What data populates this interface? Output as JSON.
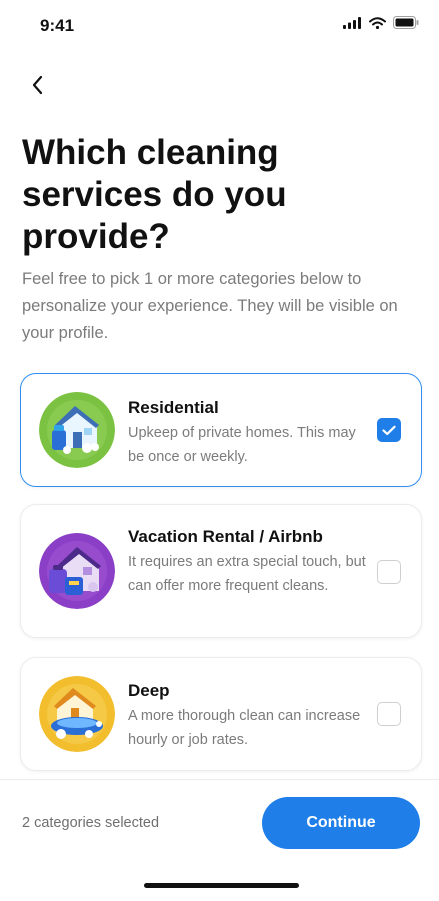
{
  "status_bar": {
    "time": "9:41"
  },
  "header": {
    "back_icon": "chevron-left-icon",
    "title": "Which cleaning services do you provide?",
    "subtitle": "Feel free to pick 1 or more categories below to personalize your experience. They will be visible on your profile."
  },
  "categories": [
    {
      "title": "Residential",
      "description": "Upkeep of private homes. This may be once or weekly.",
      "selected": true,
      "icon": "residential-house-icon",
      "icon_color": "#7cc242"
    },
    {
      "title": "Vacation Rental / Airbnb",
      "description": "It requires an extra special touch, but can offer more frequent cleans.",
      "selected": false,
      "icon": "vacation-rental-icon",
      "icon_color": "#8b3fc6"
    },
    {
      "title": "Deep",
      "description": "A more thorough clean can increase hourly or job rates.",
      "selected": false,
      "icon": "deep-clean-icon",
      "icon_color": "#f2be2e"
    }
  ],
  "footer": {
    "selected_count_text": "2 categories selected",
    "continue_label": "Continue"
  },
  "colors": {
    "accent": "#1f7ee8",
    "selected_border": "#2f8ff5",
    "muted_text": "#7b7b7b"
  }
}
